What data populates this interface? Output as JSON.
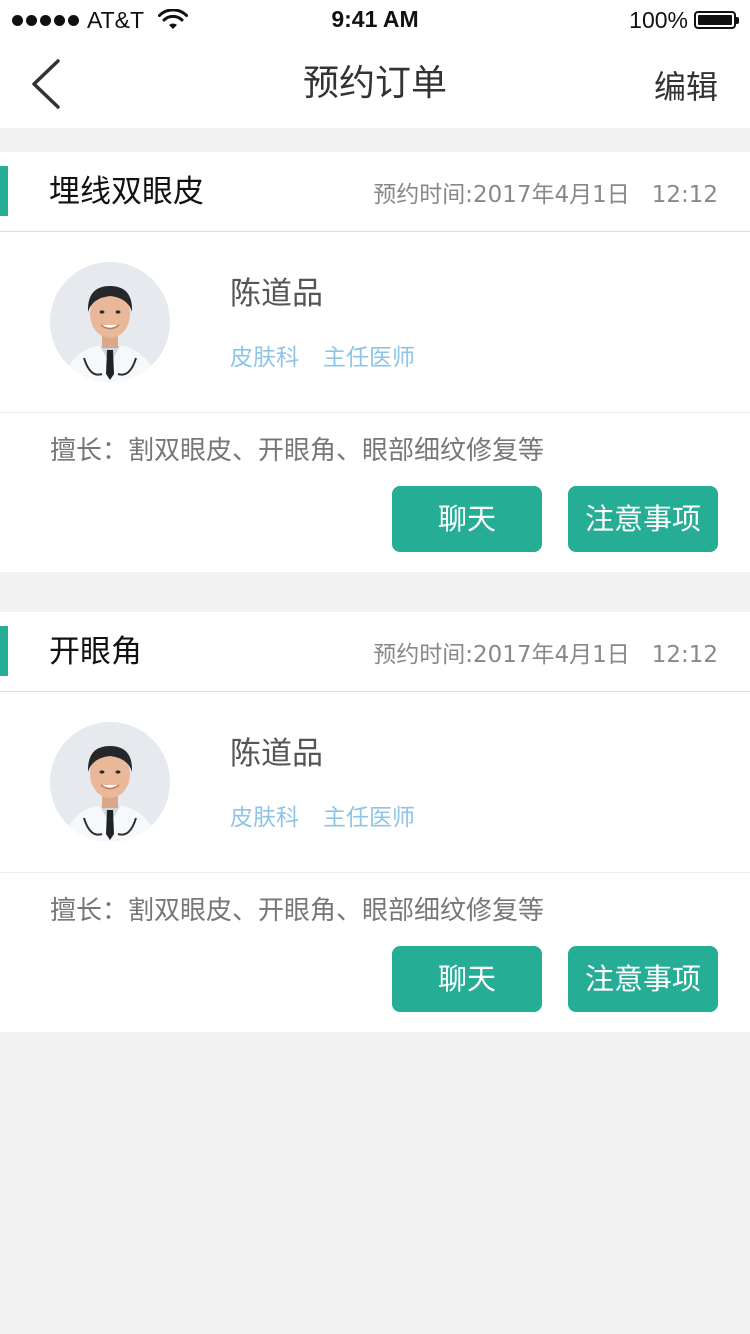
{
  "status_bar": {
    "carrier": "AT&T",
    "time": "9:41 AM",
    "battery": "100%",
    "battery_level": 1.0
  },
  "nav": {
    "title": "预约订单",
    "edit_label": "编辑"
  },
  "orders": [
    {
      "service": "埋线双眼皮",
      "appointment_time": "预约时间:2017年4月1日   12:12",
      "doctor": {
        "name": "陈道品",
        "department": "皮肤科",
        "title": "主任医师"
      },
      "specialty": "擅长：割双眼皮、开眼角、眼部细纹修复等",
      "chat_label": "聊天",
      "notes_label": "注意事项"
    },
    {
      "service": "开眼角",
      "appointment_time": "预约时间:2017年4月1日   12:12",
      "doctor": {
        "name": "陈道品",
        "department": "皮肤科",
        "title": "主任医师"
      },
      "specialty": "擅长：割双眼皮、开眼角、眼部细纹修复等",
      "chat_label": "聊天",
      "notes_label": "注意事项"
    }
  ],
  "colors": {
    "accent": "#26ad96",
    "tag_text": "#8ec5e6",
    "background": "#f1f1f1"
  }
}
